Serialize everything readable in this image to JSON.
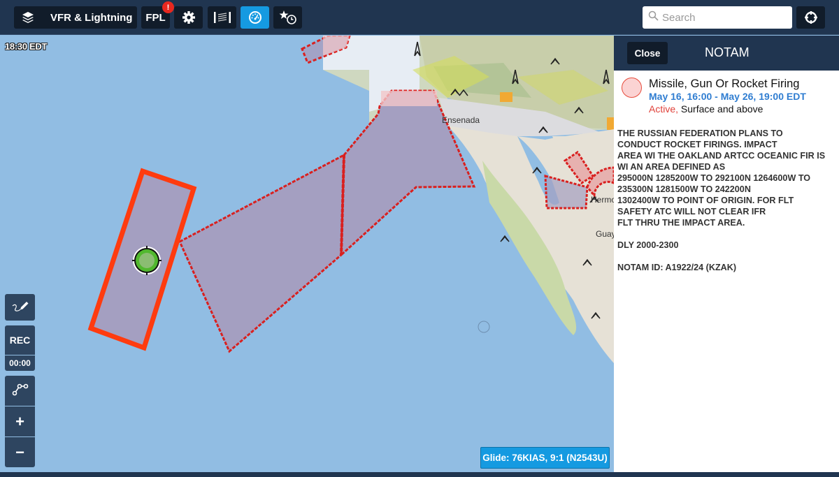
{
  "toolbar": {
    "layer_label": "VFR & Lightning",
    "fpl_label": "FPL",
    "fpl_badge": "!",
    "icons": {
      "layers": "layers-icon",
      "settings": "gear-icon",
      "wind": "wind-icon",
      "instruments": "gauge-icon",
      "favorites": "star-clock-icon",
      "locate": "crosshair-icon"
    },
    "active_button": "instruments",
    "accent_color": "#159ae1"
  },
  "search": {
    "placeholder": "Search",
    "value": ""
  },
  "map": {
    "timestamp": "18:30 EDT",
    "labels": {
      "ensenada": "Ensenada",
      "hermosillo": "Hermo",
      "guaymas": "Guay"
    },
    "airspace_colors": {
      "selected_border": "#ff3b0f",
      "restricted_border": "#d9201f",
      "fill": "#a49fc1"
    }
  },
  "left_controls": {
    "draw_icon": "pencil-icon",
    "rec_label": "REC",
    "rec_time": "00:00",
    "route_icon": "route-icon",
    "zoom_in_label": "+",
    "zoom_out_label": "−"
  },
  "glide": {
    "label": "Glide: 76KIAS, 9:1 (N2543U)"
  },
  "panel": {
    "close_label": "Close",
    "title": "NOTAM",
    "notam": {
      "type": "Missile, Gun Or Rocket Firing",
      "time_range": "May 16, 16:00 - May 26, 19:00 EDT",
      "status": "Active,",
      "altitude": " Surface and above",
      "body_lines": [
        "THE RUSSIAN FEDERATION PLANS TO\nCONDUCT ROCKET FIRINGS. IMPACT\nAREA WI THE OAKLAND ARTCC OCEANIC FIR IS\nWI AN AREA DEFINED AS\n295000N 1285200W TO 292100N 1264600W TO\n235300N 1281500W TO 242200N\n1302400W TO POINT OF ORIGIN. FOR FLT\nSAFETY ATC WILL NOT CLEAR IFR\nFLT THRU THE IMPACT AREA.",
        "DLY 2000-2300",
        "NOTAM ID: A1922/24 (KZAK)"
      ]
    }
  }
}
